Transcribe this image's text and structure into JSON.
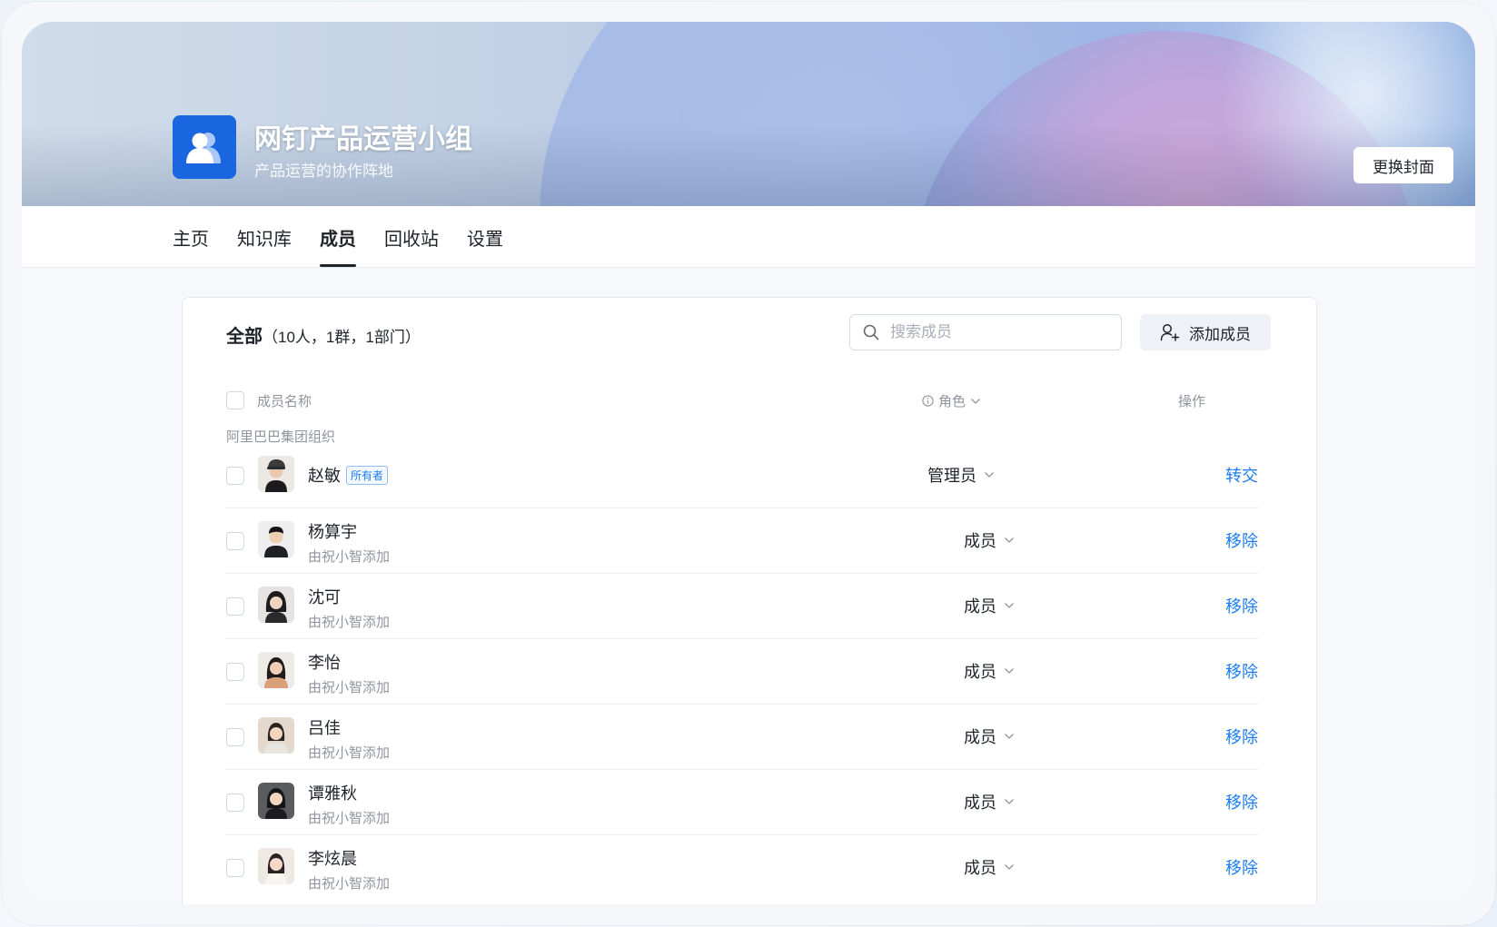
{
  "header": {
    "title": "网钉产品运营小组",
    "subtitle": "产品运营的协作阵地",
    "change_cover_label": "更换封面"
  },
  "tabs": [
    {
      "label": "主页",
      "active": false
    },
    {
      "label": "知识库",
      "active": false
    },
    {
      "label": "成员",
      "active": true
    },
    {
      "label": "回收站",
      "active": false
    },
    {
      "label": "设置",
      "active": false
    }
  ],
  "members_panel": {
    "title": "全部",
    "count": "（10人，1群，1部门）",
    "search_placeholder": "搜索成员",
    "add_label": "添加成员",
    "columns": {
      "name": "成员名称",
      "role": "角色",
      "action": "操作"
    },
    "org_label": "阿里巴巴集团组织",
    "owner_badge": "所有者",
    "rows": [
      {
        "name": "赵敏",
        "added_by": "",
        "role": "管理员",
        "action": "转交",
        "owner": true
      },
      {
        "name": "杨算宇",
        "added_by": "由祝小智添加",
        "role": "成员",
        "action": "移除",
        "owner": false
      },
      {
        "name": "沈可",
        "added_by": "由祝小智添加",
        "role": "成员",
        "action": "移除",
        "owner": false
      },
      {
        "name": "李怡",
        "added_by": "由祝小智添加",
        "role": "成员",
        "action": "移除",
        "owner": false
      },
      {
        "name": "吕佳",
        "added_by": "由祝小智添加",
        "role": "成员",
        "action": "移除",
        "owner": false
      },
      {
        "name": "谭雅秋",
        "added_by": "由祝小智添加",
        "role": "成员",
        "action": "移除",
        "owner": false
      },
      {
        "name": "李炫晨",
        "added_by": "由祝小智添加",
        "role": "成员",
        "action": "移除",
        "owner": false
      }
    ]
  },
  "colors": {
    "accent": "#1a7cf0",
    "brand_icon": "#1a66e0"
  },
  "icons": {
    "group": "group-users-icon",
    "search": "search-icon",
    "add_user": "add-user-icon",
    "info": "info-icon",
    "chevron": "chevron-down-icon"
  }
}
